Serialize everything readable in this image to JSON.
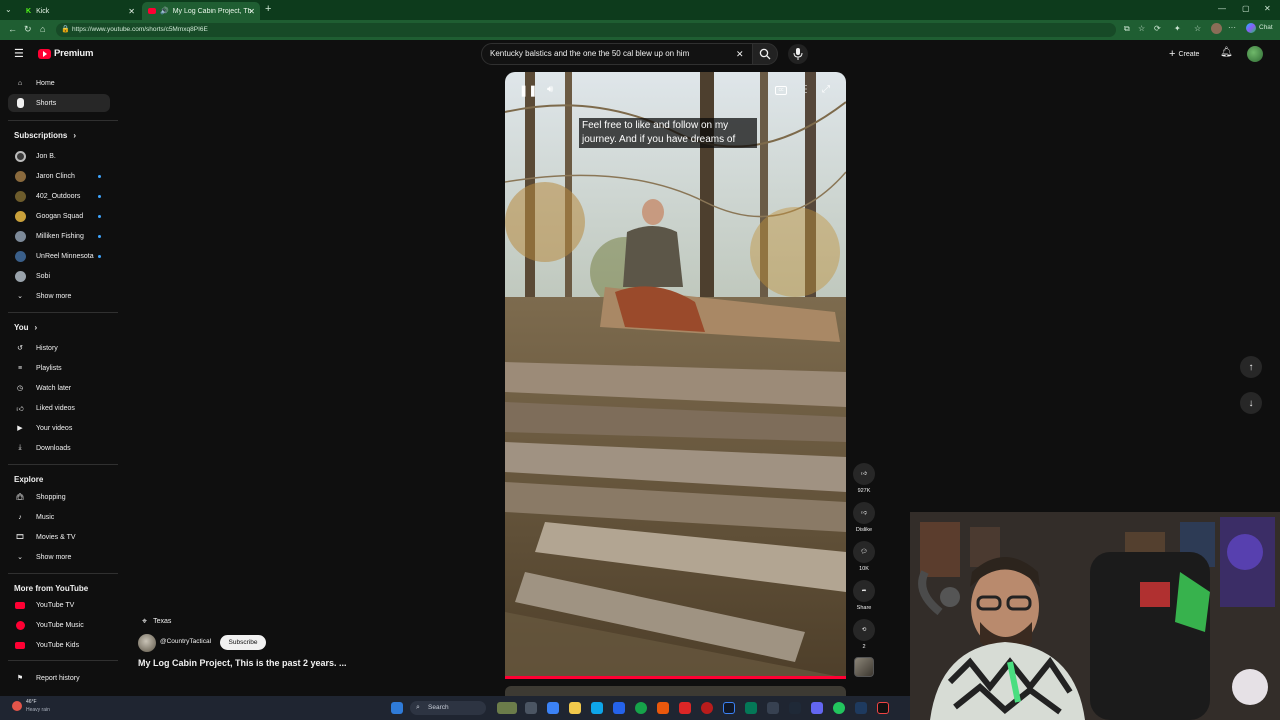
{
  "browser": {
    "tabs": [
      {
        "label": "Kick",
        "active": false
      },
      {
        "label": "My Log Cabin Project, This is",
        "active": true
      }
    ],
    "url": "https://www.youtube.com/shorts/c5Mmxq8PI6E",
    "chat_label": "Chat"
  },
  "header": {
    "brand": "Premium",
    "search_value": "Kentucky balstics and the one the 50 cal blew up on him",
    "create_label": "Create"
  },
  "sidebar": {
    "main": [
      {
        "label": "Home",
        "icon": "home-icon"
      },
      {
        "label": "Shorts",
        "icon": "shorts-icon",
        "active": true
      }
    ],
    "subscriptions_title": "Subscriptions",
    "subscriptions": [
      {
        "label": "Jon B.",
        "new": false
      },
      {
        "label": "Jaron Clinch",
        "new": true
      },
      {
        "label": "402_Outdoors",
        "new": true
      },
      {
        "label": "Googan Squad",
        "new": true
      },
      {
        "label": "Milliken Fishing",
        "new": true
      },
      {
        "label": "UnReel Minnesota",
        "new": true
      },
      {
        "label": "Sobi",
        "new": false
      }
    ],
    "show_more_1": "Show more",
    "you_title": "You",
    "you_items": [
      {
        "label": "History",
        "icon": "history-icon"
      },
      {
        "label": "Playlists",
        "icon": "playlists-icon"
      },
      {
        "label": "Watch later",
        "icon": "clock-icon"
      },
      {
        "label": "Liked videos",
        "icon": "thumbs-up-icon"
      },
      {
        "label": "Your videos",
        "icon": "video-icon"
      },
      {
        "label": "Downloads",
        "icon": "download-icon"
      }
    ],
    "explore_title": "Explore",
    "explore_items": [
      {
        "label": "Shopping",
        "icon": "bag-icon"
      },
      {
        "label": "Music",
        "icon": "music-icon"
      },
      {
        "label": "Movies & TV",
        "icon": "film-icon"
      }
    ],
    "show_more_2": "Show more",
    "more_title": "More from YouTube",
    "more_items": [
      {
        "label": "YouTube TV"
      },
      {
        "label": "YouTube Music"
      },
      {
        "label": "YouTube Kids"
      }
    ],
    "report_label": "Report history"
  },
  "short": {
    "caption_line1": "Feel free to like and follow on my",
    "caption_line2": "journey. And if you have dreams of",
    "location": "Texas",
    "channel": "@CountryTactical",
    "subscribe_label": "Subscribe",
    "title": "My Log Cabin Project, This is the past 2 years. ..."
  },
  "actions": {
    "likes": "927K",
    "dislike_label": "Dislike",
    "comments": "10K",
    "share_label": "Share",
    "remix_count": "2"
  },
  "taskbar": {
    "weather_temp": "46°F",
    "weather_desc": "Heavy rain",
    "search_label": "Search"
  },
  "colors": {
    "youtube_red": "#ff0033",
    "browser_green": "#1f5e32",
    "background": "#0f0f0f"
  }
}
